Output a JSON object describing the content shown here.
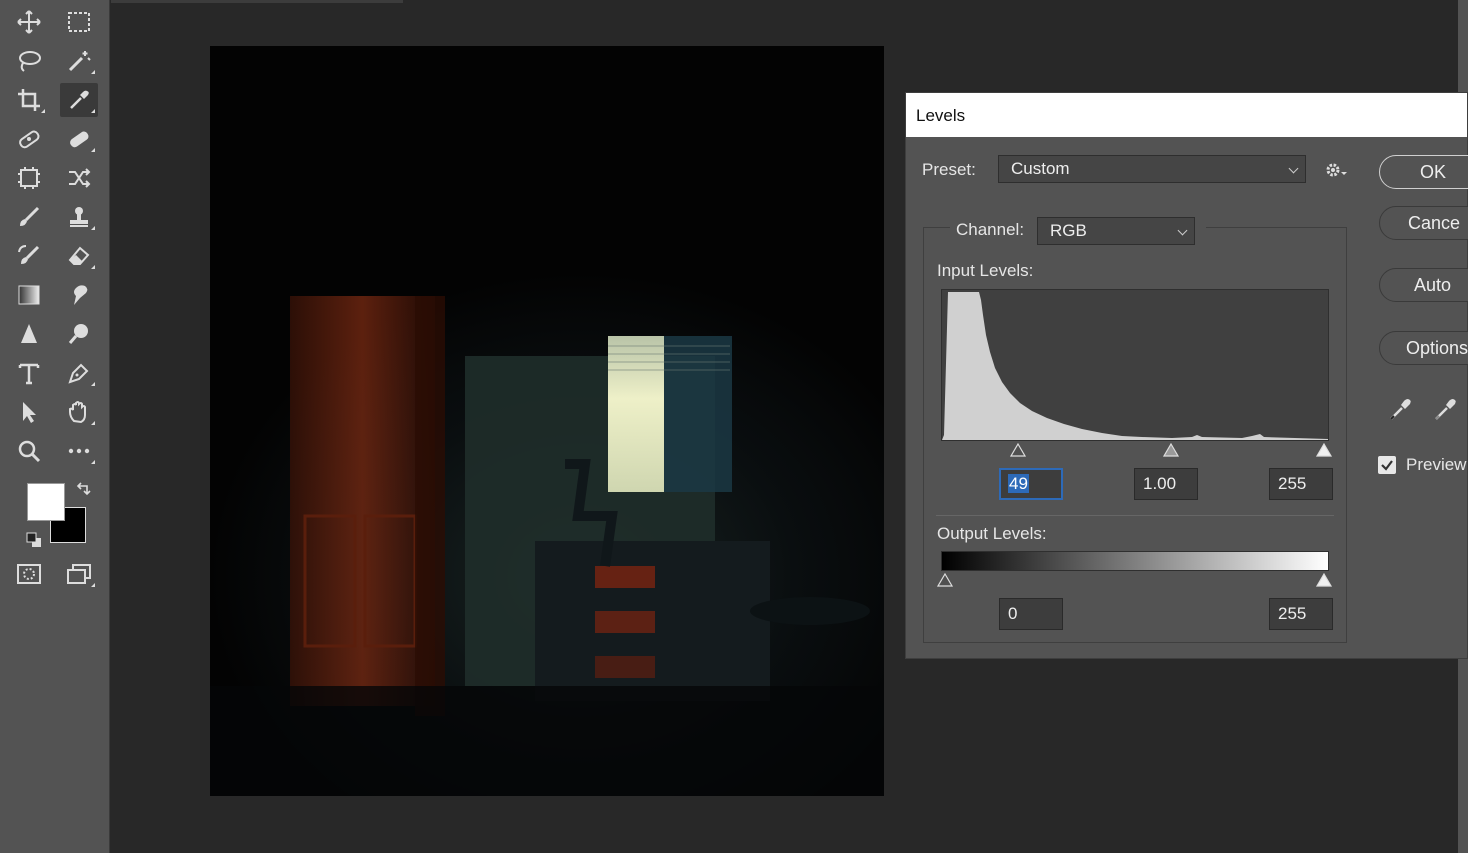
{
  "toolbar": {
    "tools": [
      "move-icon",
      "marquee-icon",
      "lasso-icon",
      "magic-wand-icon",
      "crop-icon",
      "eyedropper-icon",
      "spot-healing-icon",
      "healing-brush-icon",
      "frame-icon",
      "content-aware-move-icon",
      "brush-icon",
      "clone-stamp-icon",
      "history-brush-icon",
      "eraser-icon",
      "gradient-icon",
      "smudge-icon",
      "sharpen-icon",
      "dodge-icon",
      "type-icon",
      "pen-icon",
      "path-select-icon",
      "hand-icon",
      "zoom-icon",
      "more-icon"
    ],
    "active_tool": "eyedropper-icon",
    "foreground_color": "#ffffff",
    "background_color": "#000000"
  },
  "dialog": {
    "title": "Levels",
    "preset_label": "Preset:",
    "preset_value": "Custom",
    "channel_label": "Channel:",
    "channel_value": "RGB",
    "input_levels_label": "Input Levels:",
    "input_black": "49",
    "input_gamma": "1.00",
    "input_white": "255",
    "output_levels_label": "Output Levels:",
    "output_black": "0",
    "output_white": "255",
    "buttons": {
      "ok": "OK",
      "cancel": "Cance",
      "auto": "Auto",
      "options": "Options"
    },
    "preview_label": "Preview",
    "preview_checked": true
  },
  "colors": {
    "panel": "#535353",
    "workspace": "#282828",
    "accent": "#2d6ab8"
  }
}
